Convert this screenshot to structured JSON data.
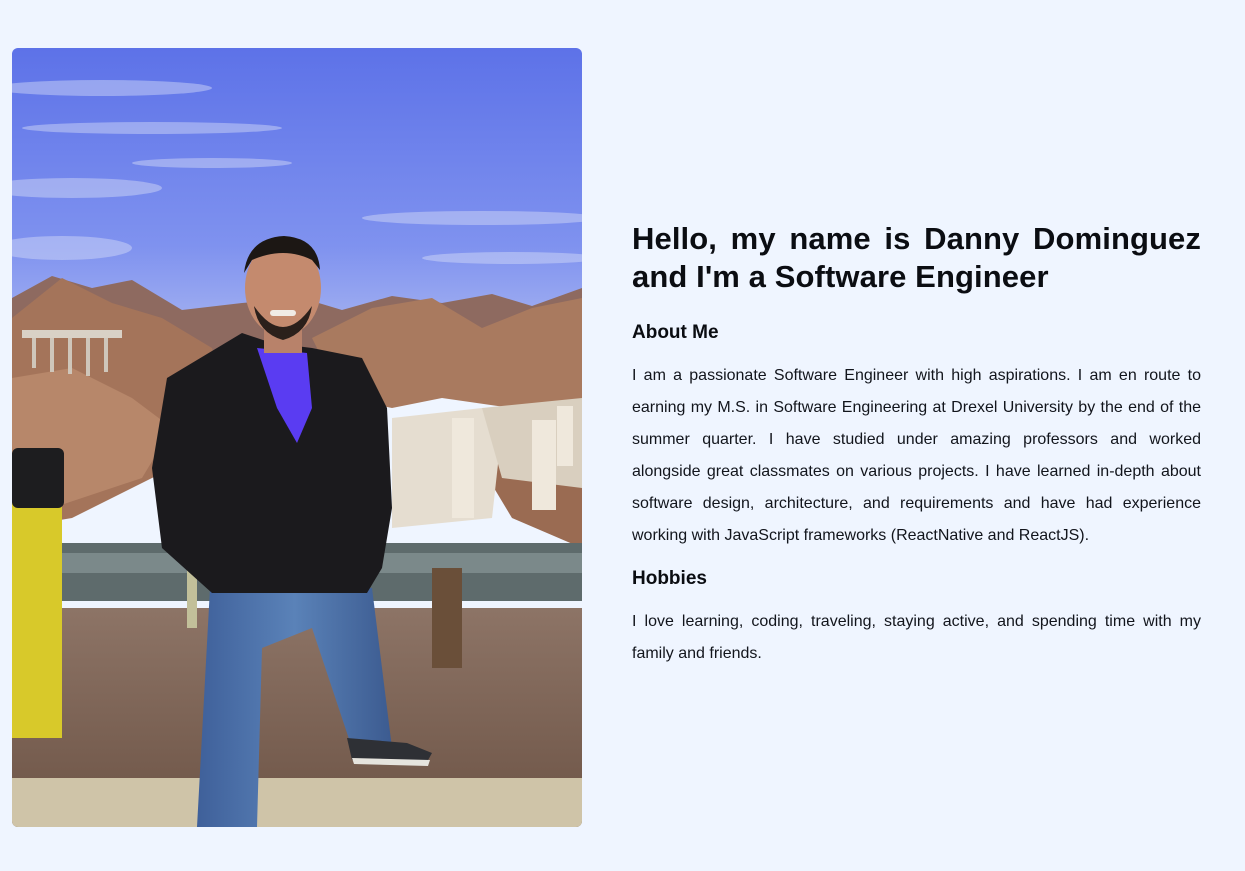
{
  "profile_photo": {
    "icon": "profile-photo",
    "description_colors": {
      "sky_top": "#5d72e8",
      "sky_bottom": "#a9b7f4",
      "rock": "#a4745a",
      "jacket": "#1b1a1d",
      "jeans": "#4b70a6",
      "shirt": "#5a3cf2",
      "barrel": "#d8c92a"
    }
  },
  "intro": {
    "headline": "Hello, my name is Danny Dominguez and I'm a Software Engineer"
  },
  "about": {
    "title": "About Me",
    "body": "I am a passionate Software Engineer with high aspirations. I am en route to earning my M.S. in Software Engineering at Drexel University by the end of the summer quarter. I have studied under amazing professors and worked alongside great classmates on various projects. I have learned in-depth about software design, architecture, and requirements and have had experience working with JavaScript frameworks (ReactNative and ReactJS)."
  },
  "hobbies": {
    "title": "Hobbies",
    "body": "I love learning, coding, traveling, staying active, and spending time with my family and friends."
  }
}
